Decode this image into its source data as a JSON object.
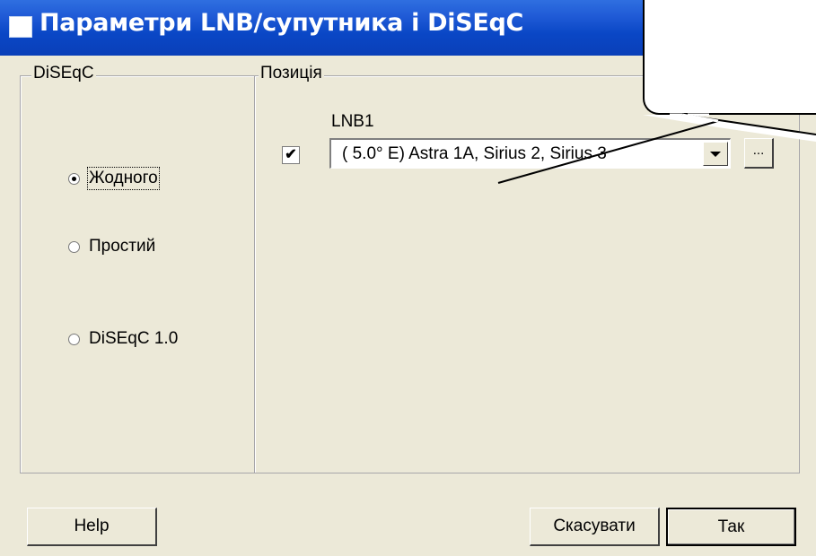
{
  "window": {
    "title": "Параметри LNB/супутника і DiSEqC",
    "close_glyph": "✕"
  },
  "diseqc_group": {
    "legend": "DiSEqC",
    "options": [
      {
        "label": "Жодного",
        "checked": true
      },
      {
        "label": "Простий",
        "checked": false
      },
      {
        "label": "DiSEqC 1.0",
        "checked": false
      }
    ]
  },
  "position_group": {
    "legend": "Позиція",
    "lnb_label": "LNB1",
    "lnb_checked": true,
    "checkbox_glyph": "✔",
    "satellite_value": "(   5.0° E) Astra 1A, Sirius 2, Sirius 3",
    "browse_label": "..."
  },
  "buttons": {
    "help": "Help",
    "cancel": "Скасувати",
    "ok": "Так"
  }
}
